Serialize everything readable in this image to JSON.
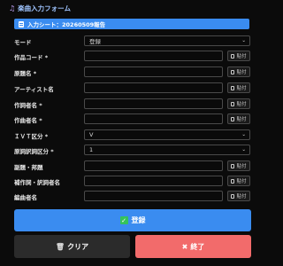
{
  "header": {
    "title": "楽曲入力フォーム"
  },
  "banner": {
    "text": "入力シート：20260509報告"
  },
  "paste_label": "貼付",
  "form": [
    {
      "label": "モード",
      "value": "登録",
      "type": "select"
    },
    {
      "label": "作品コード *",
      "value": "",
      "type": "text"
    },
    {
      "label": "原題名 *",
      "value": "",
      "type": "text"
    },
    {
      "label": "アーティスト名",
      "value": "",
      "type": "text"
    },
    {
      "label": "作詞者名 *",
      "value": "",
      "type": "text"
    },
    {
      "label": "作曲者名 *",
      "value": "",
      "type": "text"
    },
    {
      "label": "ＩＶＴ区分 *",
      "value": "V",
      "type": "select"
    },
    {
      "label": "原詞訳詞区分 *",
      "value": "1",
      "type": "select"
    },
    {
      "label": "副題・邦題",
      "value": "",
      "type": "text"
    },
    {
      "label": "補作詞・訳詞者名",
      "value": "",
      "type": "text"
    },
    {
      "label": "編曲者名",
      "value": "",
      "type": "text"
    }
  ],
  "buttons": {
    "register": "登録",
    "clear": "クリア",
    "exit": "終了"
  },
  "colors": {
    "primary": "#3a8cf0",
    "danger": "#f26b6b",
    "background": "#0b0b0b"
  }
}
